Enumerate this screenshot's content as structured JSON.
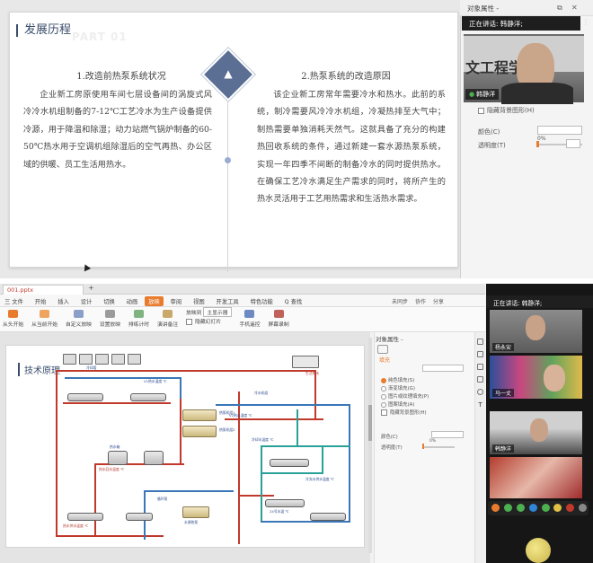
{
  "top_slide": {
    "title": "发展历程",
    "ghost": "PART 01",
    "left_heading": "1.改造前热泵系统状况",
    "left_body": "企业新工房原使用车间七层设备间的涡旋式风冷冷水机组制备的7-12℃工艺冷水为生产设备提供冷源，用于降温和除湿；动力站燃气锅炉制备的60-50℃热水用于空调机组除湿后的空气再热、办公区域的供暖、员工生活用热水。",
    "right_heading": "2.热泵系统的改造原因",
    "right_body": "该企业新工房常年需要冷水和热水。此前的系统，制冷需要风冷冷水机组，冷凝热排至大气中；制热需要单独消耗天然气。这就具备了充分的构建热回收系统的条件，通过新建一套水源热泵系统，实现一年四季不间断的制备冷水的同时提供热水。在确保工艺冷水满足生产需求的同时，将所产生的热水灵活用于工艺用热需求和生活热水需求。"
  },
  "top_panel": {
    "header": "对象属性 -",
    "speaking": "正在讲话: 韩静洋;",
    "video_text": "文工程学",
    "speaker_name": "韩静洋",
    "hide_bg": "隐藏背景图形(H)",
    "color_label": "颜色(C)",
    "transparency_label": "透明度(T)",
    "transparency_value": "0%"
  },
  "bottom_app": {
    "file_tab": "001.pptx",
    "add_tab": "+",
    "menus": [
      "三 文件",
      "开始",
      "插入",
      "设计",
      "切换",
      "动画",
      "放映",
      "审阅",
      "视图",
      "开发工具",
      "特色功能",
      "Q 查找"
    ],
    "active_menu": "放映",
    "menu_right": [
      "未同步",
      "协作",
      "分享"
    ],
    "ribbon": [
      "从头开始",
      "从当前开始",
      "自定义放映",
      "设置放映",
      "排练计时",
      "演讲备注",
      "放映到",
      "隐藏幻灯片",
      "手机遥控",
      "屏幕录制"
    ],
    "ribbon_select": "主显示器",
    "slide_title": "技术原理",
    "panel_header": "对象属性 -",
    "panel_section": "填充",
    "fill_options": [
      "纯色填充(S)",
      "渐变填充(G)",
      "图片或纹理填充(P)",
      "图案填充(A)",
      "隐藏背景图形(H)"
    ],
    "panel_color": "颜色(C)",
    "panel_transparency": "透明度(T)",
    "panel_transparency_value": "0%",
    "side_tool_last": "T"
  },
  "bottom_video": {
    "speaking": "正在讲话: 韩静洋;",
    "tiles": [
      "杨永安",
      "马一丈",
      "韩静洋",
      ""
    ]
  },
  "diagram_labels": {
    "l1": "V1热水温度 ℃",
    "l2": "V2热水温度 ℃",
    "l3": "热泵机组1",
    "l4": "热泵机组2",
    "l5": "冷水机组",
    "l6": "冷却水温度 ℃",
    "l7": "热水回水温度 ℃",
    "l8": "冷冻水供水温度 ℃",
    "l9": "热水箱",
    "l10": "热水供水温度 ℃",
    "l11": "循环泵",
    "l12": "24号水温 ℃",
    "l13": "冷却塔",
    "l14": "生活热水",
    "l15": "水源热泵"
  }
}
